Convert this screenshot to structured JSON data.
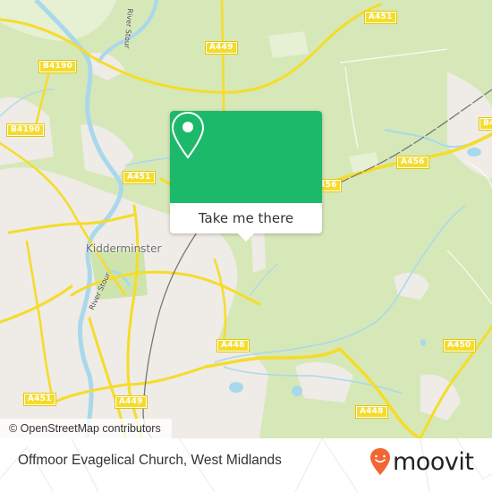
{
  "map": {
    "place_labels": [
      {
        "name": "kidderminster",
        "text": "Kidderminster"
      }
    ],
    "river_labels": [
      {
        "name": "river-stour-north",
        "text": "River Stour"
      },
      {
        "name": "river-stour-south",
        "text": "River Stour"
      }
    ],
    "road_labels": [
      {
        "text": "A449"
      },
      {
        "text": "A451"
      },
      {
        "text": "B4190"
      },
      {
        "text": "B4190"
      },
      {
        "text": "A451"
      },
      {
        "text": "A456"
      },
      {
        "text": "A456"
      },
      {
        "text": "B4"
      },
      {
        "text": "A448"
      },
      {
        "text": "A450"
      },
      {
        "text": "A448"
      },
      {
        "text": "A451"
      },
      {
        "text": "A449"
      }
    ],
    "colors": {
      "land": "#d6e8b8",
      "urban": "#efebe6",
      "water": "#a9d8ec",
      "road": "#f5dc2a",
      "rail": "#777777"
    }
  },
  "popup": {
    "icon": "location-pin-icon",
    "button_label": "Take me there",
    "accent_color": "#1db96a"
  },
  "attribution": "© OpenStreetMap contributors",
  "footer": {
    "title": "Offmoor Evagelical Church, West Midlands",
    "logo_text": "moovit",
    "logo_color": "#f26534"
  }
}
